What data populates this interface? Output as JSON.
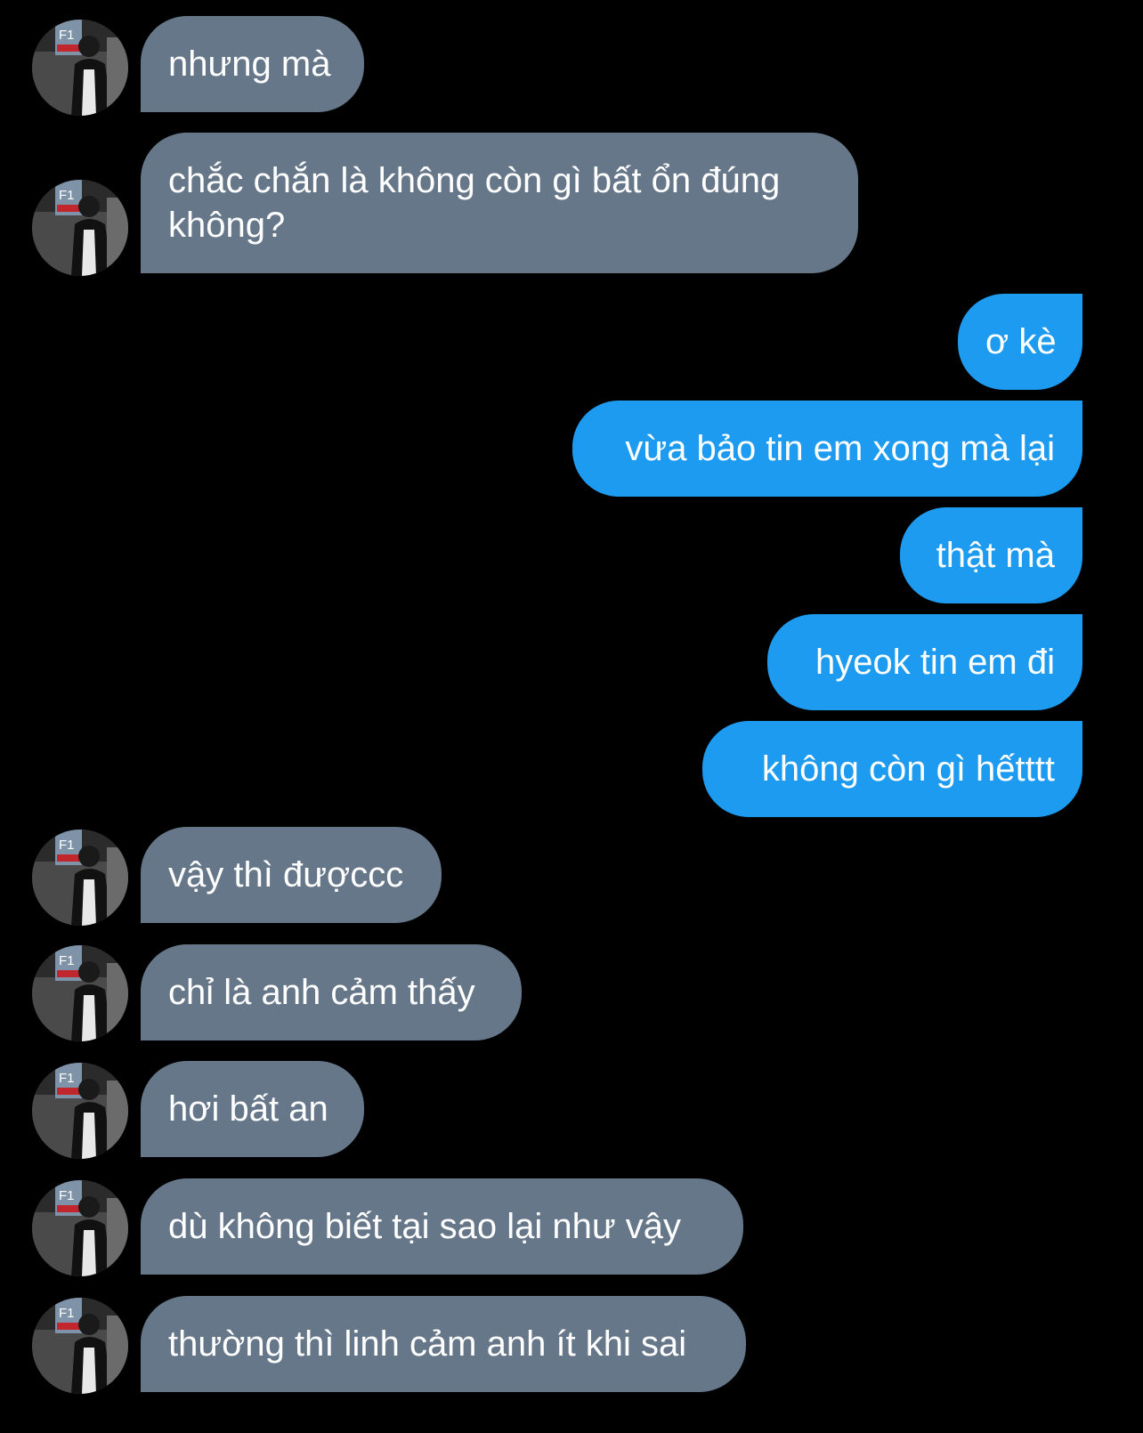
{
  "colors": {
    "background": "#000000",
    "incoming_bubble": "#66778a",
    "outgoing_bubble": "#1d9bf0",
    "text": "#ffffff"
  },
  "avatar": {
    "icon": "user-avatar-photo",
    "badge_text": "F1"
  },
  "messages": [
    {
      "direction": "incoming",
      "text": "nhưng mà"
    },
    {
      "direction": "incoming",
      "text": "chắc chắn là không còn gì bất ổn đúng không?"
    },
    {
      "direction": "outgoing",
      "text": "ơ kè"
    },
    {
      "direction": "outgoing",
      "text": "vừa bảo tin em xong mà lại"
    },
    {
      "direction": "outgoing",
      "text": "thật mà"
    },
    {
      "direction": "outgoing",
      "text": "hyeok tin em đi"
    },
    {
      "direction": "outgoing",
      "text": "không còn gì hếtttt"
    },
    {
      "direction": "incoming",
      "text": "vậy thì đượccc"
    },
    {
      "direction": "incoming",
      "text": "chỉ là anh cảm thấy"
    },
    {
      "direction": "incoming",
      "text": "hơi bất an"
    },
    {
      "direction": "incoming",
      "text": "dù không biết tại sao lại như vậy"
    },
    {
      "direction": "incoming",
      "text": "thường thì linh cảm anh ít khi sai"
    }
  ]
}
